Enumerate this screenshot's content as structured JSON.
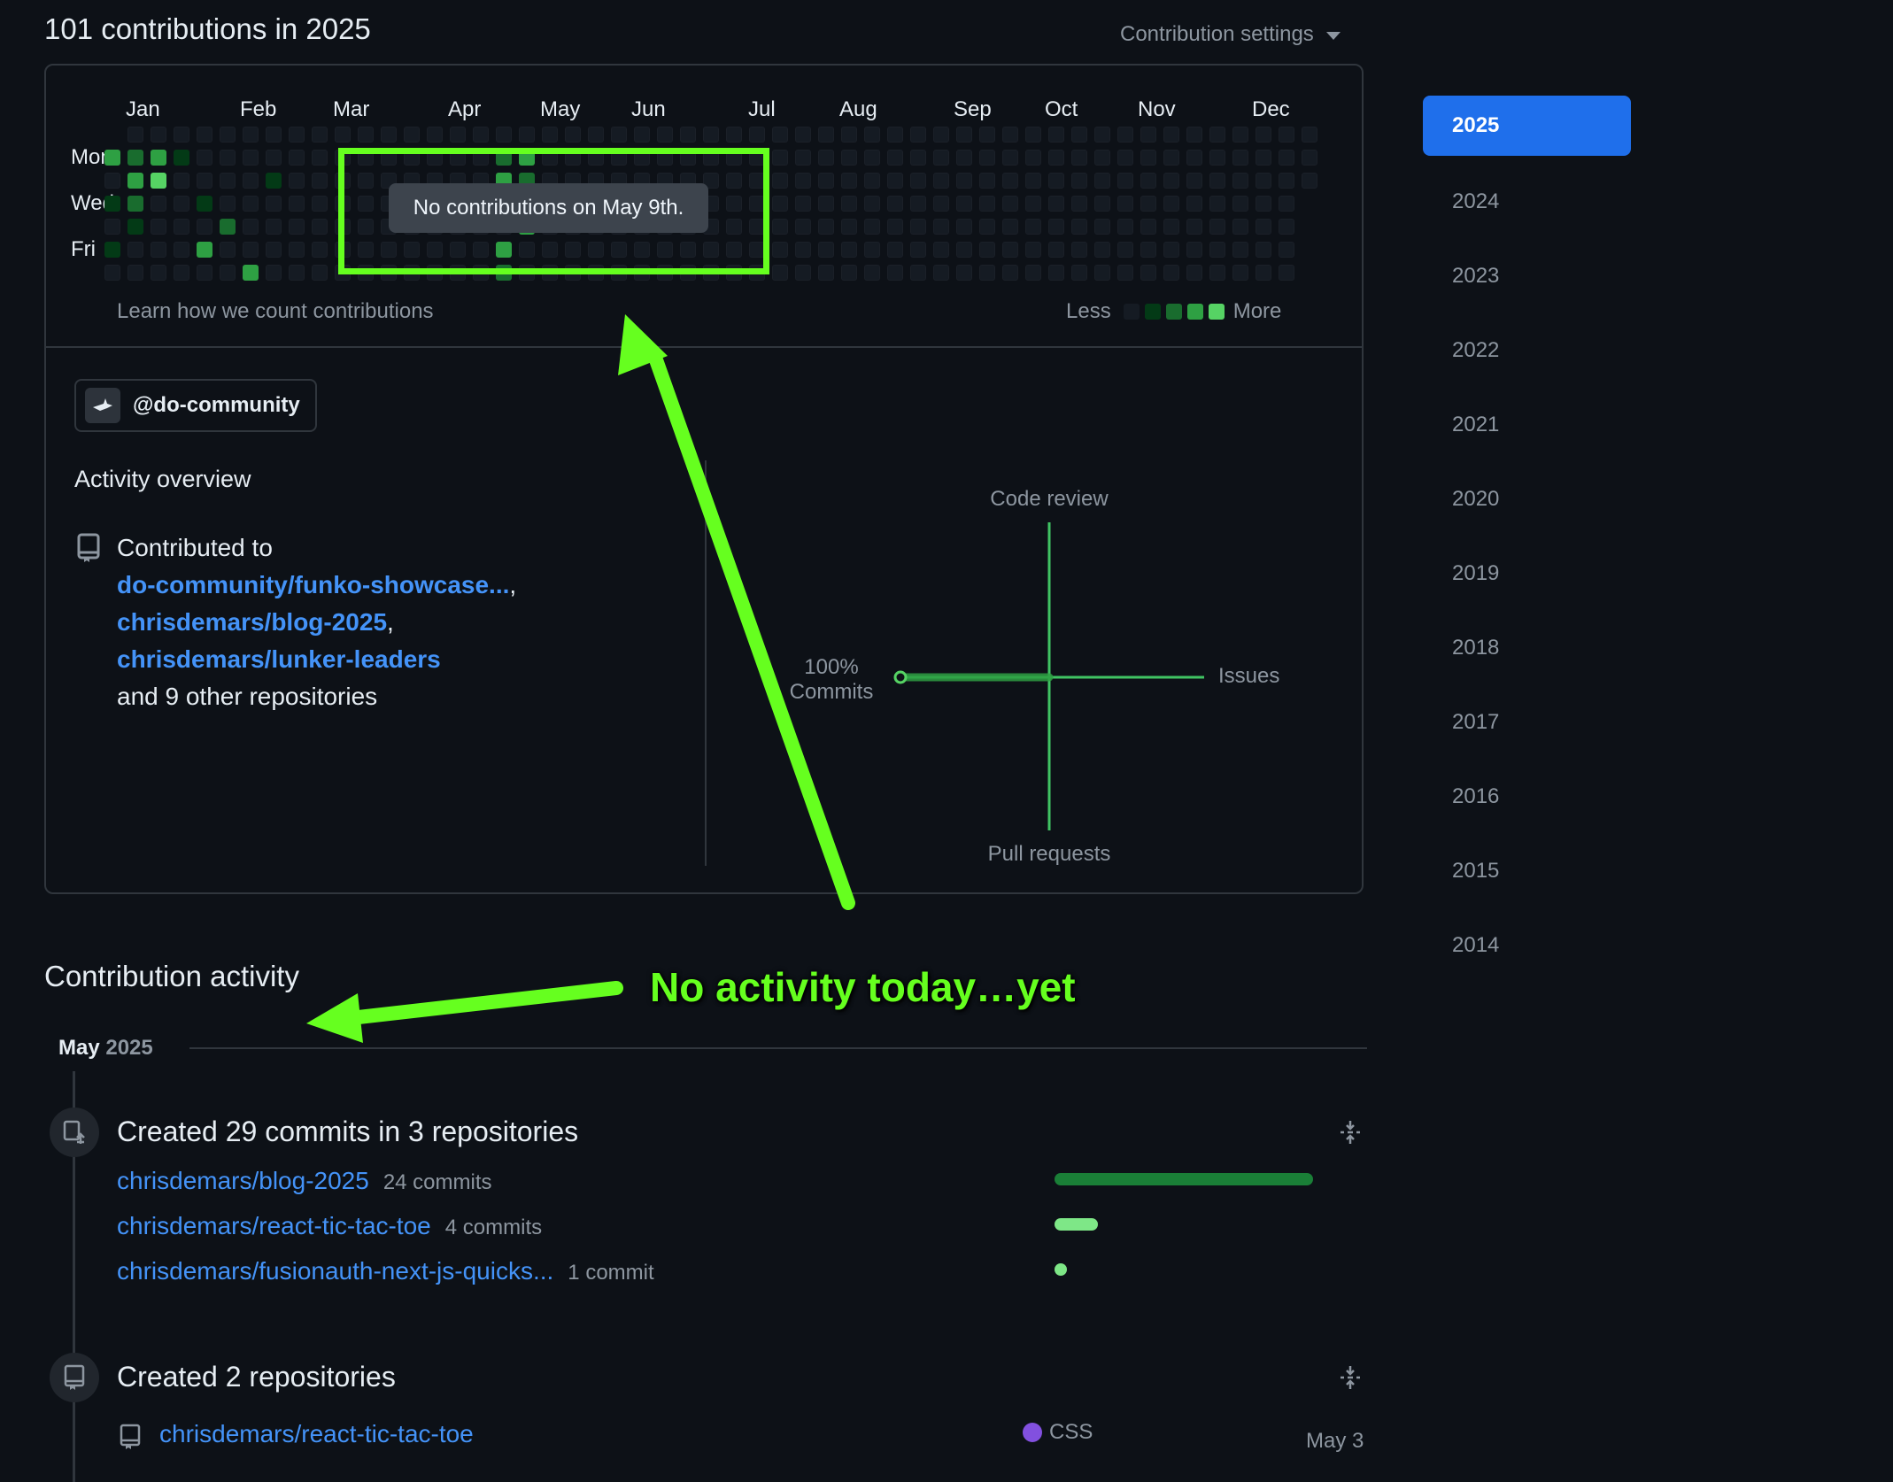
{
  "header": {
    "title": "101 contributions in 2025",
    "settings_label": "Contribution settings"
  },
  "calendar": {
    "months": [
      "Jan",
      "Feb",
      "Mar",
      "Apr",
      "May",
      "Jun",
      "Jul",
      "Aug",
      "Sep",
      "Oct",
      "Nov",
      "Dec"
    ],
    "days": [
      "Mon",
      "Wed",
      "Fri"
    ],
    "learn_link": "Learn how we count contributions",
    "legend_less": "Less",
    "legend_more": "More",
    "level_colors": [
      "#151b23",
      "#033a16",
      "#196c2e",
      "#2ea043",
      "#56d364"
    ],
    "tooltip": "No contributions on May 9th."
  },
  "org": {
    "handle": "@do-community"
  },
  "overview": {
    "title": "Activity overview",
    "contributed_to": "Contributed to",
    "repos": [
      "do-community/funko-showcase...",
      "chrisdemars/blog-2025",
      "chrisdemars/lunker-leaders"
    ],
    "other": "and 9 other repositories",
    "axes": {
      "top": "Code review",
      "bottom": "Pull requests",
      "left_pct": "100%",
      "left": "Commits",
      "right": "Issues"
    }
  },
  "years": {
    "active": "2025",
    "list": [
      "2024",
      "2023",
      "2022",
      "2021",
      "2020",
      "2019",
      "2018",
      "2017",
      "2016",
      "2015",
      "2014"
    ]
  },
  "activity": {
    "title": "Contribution activity",
    "annotation": "No activity today…yet",
    "month": "May",
    "year": "2025",
    "commits_group": {
      "title": "Created 29 commits in 3 repositories",
      "rows": [
        {
          "repo": "chrisdemars/blog-2025",
          "count": "24 commits"
        },
        {
          "repo": "chrisdemars/react-tic-tac-toe",
          "count": "4 commits"
        },
        {
          "repo": "chrisdemars/fusionauth-next-js-quicks...",
          "count": "1 commit"
        }
      ]
    },
    "repos_group": {
      "title": "Created 2 repositories",
      "rows": [
        {
          "repo": "chrisdemars/react-tic-tac-toe",
          "language": "CSS",
          "date": "May 3"
        }
      ]
    }
  }
}
